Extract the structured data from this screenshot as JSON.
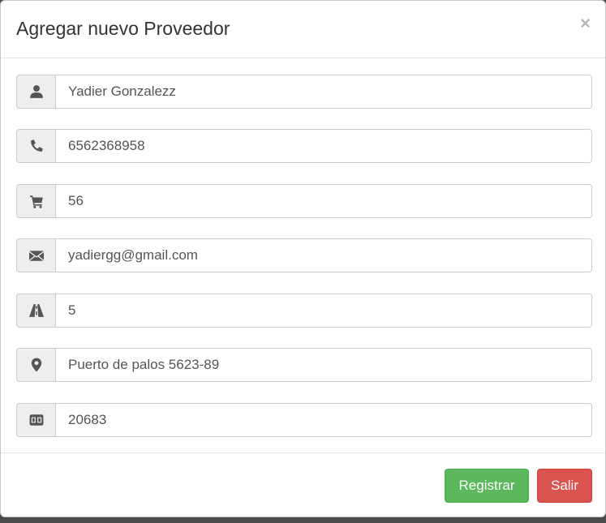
{
  "modal": {
    "title": "Agregar nuevo Proveedor",
    "close_label": "×"
  },
  "form": {
    "fields": [
      {
        "icon": "user-icon",
        "value": "Yadier Gonzalezz"
      },
      {
        "icon": "phone-icon",
        "value": "6562368958"
      },
      {
        "icon": "cart-icon",
        "value": "56"
      },
      {
        "icon": "envelope-icon",
        "value": "yadiergg@gmail.com"
      },
      {
        "icon": "road-icon",
        "value": "5"
      },
      {
        "icon": "map-marker-icon",
        "value": "Puerto de palos 5623-89"
      },
      {
        "icon": "subtitles-icon",
        "value": "20683"
      }
    ]
  },
  "footer": {
    "submit_label": "Registrar",
    "exit_label": "Salir"
  },
  "colors": {
    "success": "#5cb85c",
    "danger": "#d9534f",
    "addon_bg": "#eeeeee",
    "icon": "#555555"
  }
}
